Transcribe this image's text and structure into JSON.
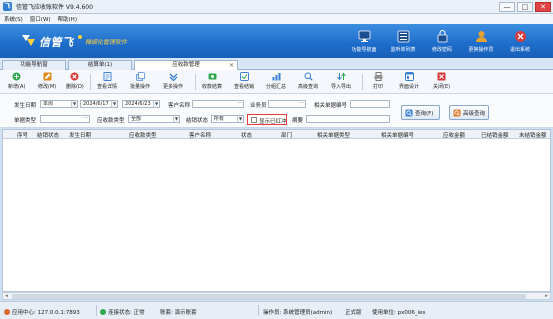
{
  "window": {
    "title": "信管飞应收账软件 V9.4.600",
    "min": "—",
    "max": "□",
    "close": "✕"
  },
  "menu": [
    "系统(S)",
    "窗口(W)",
    "帮助(H)"
  ],
  "brand": {
    "name": "信管飞",
    "slogan": "精细化管理软件"
  },
  "quick_buttons": [
    {
      "label": "功能导航面",
      "icon": "monitor-icon",
      "color": "#1b4f91"
    },
    {
      "label": "监听单列表",
      "icon": "list-icon",
      "color": "#1b4f91"
    },
    {
      "label": "修改密码",
      "icon": "lock-icon",
      "color": "#1b4f91"
    },
    {
      "label": "更换操作员",
      "icon": "user-icon",
      "color": "#e6a12f"
    },
    {
      "label": "退出系统",
      "icon": "exit-icon",
      "color": "#d93b3b"
    }
  ],
  "tabs": [
    {
      "label": "功能导航窗"
    },
    {
      "label": "结算单(1)"
    },
    {
      "label": "应收款管理",
      "close": "×"
    }
  ],
  "toolbar": [
    {
      "label": "新增(A)",
      "icon": "plus-icon",
      "color": "#2fa84f"
    },
    {
      "label": "修改(M)",
      "icon": "edit-icon",
      "color": "#e08a1a"
    },
    {
      "label": "删除(D)",
      "icon": "delete-icon",
      "color": "#d63b3b"
    },
    {
      "label": "查看详情",
      "icon": "detail-icon",
      "color": "#3b80d6"
    },
    {
      "label": "批量操作",
      "icon": "batch-icon",
      "color": "#3b80d6"
    },
    {
      "label": "更多操作",
      "icon": "more-icon",
      "color": "#3b80d6"
    },
    {
      "label": "收款结算",
      "icon": "settle-icon",
      "color": "#2fa84f"
    },
    {
      "label": "查看结销",
      "icon": "view-settle-icon",
      "color": "#3b80d6"
    },
    {
      "label": "分组汇总",
      "icon": "group-icon",
      "color": "#3b80d6"
    },
    {
      "label": "高级查询",
      "icon": "advanced-search-icon",
      "color": "#3b80d6"
    },
    {
      "label": "导入导出",
      "icon": "import-export-icon",
      "color": "#3b80d6"
    },
    {
      "label": "打印",
      "icon": "print-icon",
      "color": "#777777"
    },
    {
      "label": "界面设计",
      "icon": "design-icon",
      "color": "#3b80d6"
    },
    {
      "label": "关闭(E)",
      "icon": "close-icon",
      "color": "#d63b3b"
    }
  ],
  "filters": {
    "date_label": "发生日期",
    "period": "本周",
    "date_from": "2024/6/17",
    "date_to": "2024/6/23",
    "customer_label": "客户名称",
    "customer_value": "",
    "salesman_label": "业务员",
    "salesman_value": "",
    "related_no_label": "相关单据编号",
    "related_no_value": "",
    "doc_type_label": "单据类型",
    "doc_type_value": "",
    "ar_type_label": "应收款类型",
    "ar_type_value": "全部",
    "settle_status_label": "结销状态",
    "settle_status_value": "所有",
    "red_chk_label": "显示已红冲",
    "summary_label": "摘要",
    "summary_value": "",
    "query_btn": "查询(F)",
    "adv_query_btn": "高级查询"
  },
  "grid": {
    "columns": [
      "序号",
      "结销状态",
      "发生日期",
      "应收款类型",
      "客户名称",
      "状态",
      "部门",
      "相关单据类型",
      "相关单据编号",
      "应收金额",
      "已结销金额",
      "未结销金额"
    ],
    "rows": []
  },
  "status": {
    "app_center": "应用中心: 127.0.0.1:7893",
    "connection": "连接状态: 正常",
    "account": "账套: 演示账套",
    "operator": "操作员: 系统管理员(admin)",
    "edition": "正式版",
    "user": "使用单位: px006_ies"
  },
  "colors": {
    "accent": "#1d6ccb",
    "highlight": "#e53b3b",
    "brand_yellow": "#ffd23b"
  }
}
